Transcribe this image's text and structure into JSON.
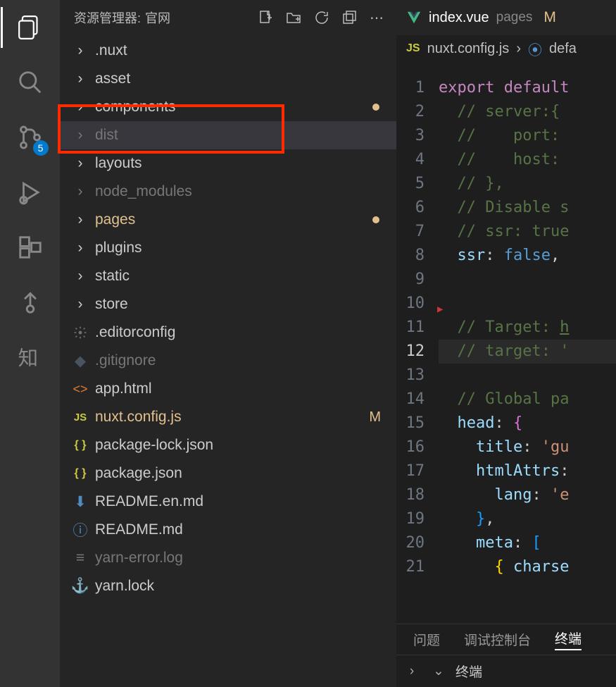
{
  "activity": {
    "scm_badge": "5"
  },
  "sidebar": {
    "title_prefix": "资源管理器:",
    "title": "官网",
    "items": [
      {
        "type": "folder",
        "name": ".nuxt"
      },
      {
        "type": "folder",
        "name": "asset"
      },
      {
        "type": "folder",
        "name": "components",
        "mod_dot": true
      },
      {
        "type": "folder",
        "name": "dist",
        "dim": true,
        "selected": true
      },
      {
        "type": "folder",
        "name": "layouts"
      },
      {
        "type": "folder",
        "name": "node_modules",
        "dim": true
      },
      {
        "type": "folder",
        "name": "pages",
        "modified": true,
        "mod_dot": true
      },
      {
        "type": "folder",
        "name": "plugins"
      },
      {
        "type": "folder",
        "name": "static"
      },
      {
        "type": "folder",
        "name": "store"
      },
      {
        "type": "file",
        "name": ".editorconfig",
        "icon": "gear"
      },
      {
        "type": "file",
        "name": ".gitignore",
        "icon": "git",
        "dim": true
      },
      {
        "type": "file",
        "name": "app.html",
        "icon": "html"
      },
      {
        "type": "file",
        "name": "nuxt.config.js",
        "icon": "js",
        "modified": true,
        "m_letter": "M"
      },
      {
        "type": "file",
        "name": "package-lock.json",
        "icon": "json"
      },
      {
        "type": "file",
        "name": "package.json",
        "icon": "json"
      },
      {
        "type": "file",
        "name": "README.en.md",
        "icon": "md"
      },
      {
        "type": "file",
        "name": "README.md",
        "icon": "info"
      },
      {
        "type": "file",
        "name": "yarn-error.log",
        "icon": "log",
        "dim": true
      },
      {
        "type": "file",
        "name": "yarn.lock",
        "icon": "yarn"
      }
    ]
  },
  "tab": {
    "filename": "index.vue",
    "folder": "pages",
    "status": "M"
  },
  "breadcrumb": {
    "file": "nuxt.config.js",
    "symbol": "defa"
  },
  "code": {
    "lines": [
      {
        "n": 1,
        "html": "<span class='tok-kw'>export</span> <span class='tok-kw'>default</span>"
      },
      {
        "n": 2,
        "html": "  <span class='tok-cm'>// server:{</span>"
      },
      {
        "n": 3,
        "html": "  <span class='tok-cm'>//    port:</span>"
      },
      {
        "n": 4,
        "html": "  <span class='tok-cm'>//    host:</span>"
      },
      {
        "n": 5,
        "html": "  <span class='tok-cm'>// },</span>"
      },
      {
        "n": 6,
        "html": "  <span class='tok-cm'>// Disable s</span>"
      },
      {
        "n": 7,
        "html": "  <span class='tok-cm'>// ssr: true</span>"
      },
      {
        "n": 8,
        "html": "  <span class='tok-prop'>ssr</span>: <span class='tok-kw2'>false</span>,"
      },
      {
        "n": 9,
        "html": ""
      },
      {
        "n": 10,
        "html": "",
        "marker": true
      },
      {
        "n": 11,
        "html": "  <span class='tok-cm'>// Target: </span><span class='tok-link'>h</span>"
      },
      {
        "n": 12,
        "html": "  <span class='tok-cm'>// target: '</span>",
        "current": true,
        "hl": true
      },
      {
        "n": 13,
        "html": ""
      },
      {
        "n": 14,
        "html": "  <span class='tok-cm'>// Global pa</span>"
      },
      {
        "n": 15,
        "html": "  <span class='tok-prop'>head</span>: <span class='tok-br2'>{</span>"
      },
      {
        "n": 16,
        "html": "    <span class='tok-prop'>title</span>: <span class='tok-str'>'gu</span>"
      },
      {
        "n": 17,
        "html": "    <span class='tok-prop'>htmlAttrs</span>:"
      },
      {
        "n": 18,
        "html": "      <span class='tok-prop'>lang</span>: <span class='tok-str'>'e</span>"
      },
      {
        "n": 19,
        "html": "    <span class='tok-br3'>}</span>,"
      },
      {
        "n": 20,
        "html": "    <span class='tok-prop'>meta</span>: <span class='tok-br3'>[</span>"
      },
      {
        "n": 21,
        "html": "      <span class='tok-br'>{</span> <span class='tok-prop'>charse</span>"
      }
    ]
  },
  "panel": {
    "tabs": [
      "问题",
      "调试控制台",
      "终端"
    ],
    "active": 2,
    "terminal_title": "终端"
  }
}
